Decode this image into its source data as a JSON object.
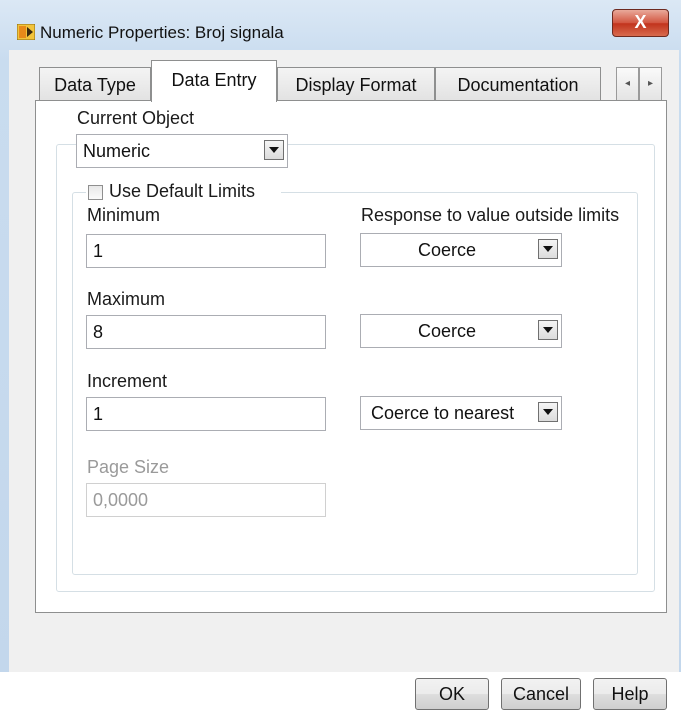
{
  "window": {
    "title": "Numeric Properties: Broj signala",
    "close_label": "X"
  },
  "tabs": [
    {
      "label": "Data Type",
      "active": false
    },
    {
      "label": "Data Entry",
      "active": true
    },
    {
      "label": "Display Format",
      "active": false
    },
    {
      "label": "Documentation",
      "active": false
    }
  ],
  "tab_scroll": {
    "left": "◂",
    "right": "▸"
  },
  "current_object": {
    "label": "Current Object",
    "value": "Numeric"
  },
  "limits": {
    "use_default_label": "Use Default Limits",
    "use_default_checked": false,
    "response_label": "Response to value outside limits",
    "minimum": {
      "label": "Minimum",
      "value": "1",
      "response": "Coerce"
    },
    "maximum": {
      "label": "Maximum",
      "value": "8",
      "response": "Coerce"
    },
    "increment": {
      "label": "Increment",
      "value": "1",
      "response": "Coerce to nearest"
    },
    "page_size": {
      "label": "Page Size",
      "value": "0,0000",
      "disabled": true
    }
  },
  "buttons": {
    "ok": "OK",
    "cancel": "Cancel",
    "help": "Help"
  },
  "colors": {
    "title_bar": "#c9dcef",
    "close_button": "#c1331c",
    "panel": "#ffffff",
    "client": "#f0f0f0"
  },
  "icons": {
    "app": "labview-vi-icon",
    "dropdown": "chevron-down-icon"
  }
}
